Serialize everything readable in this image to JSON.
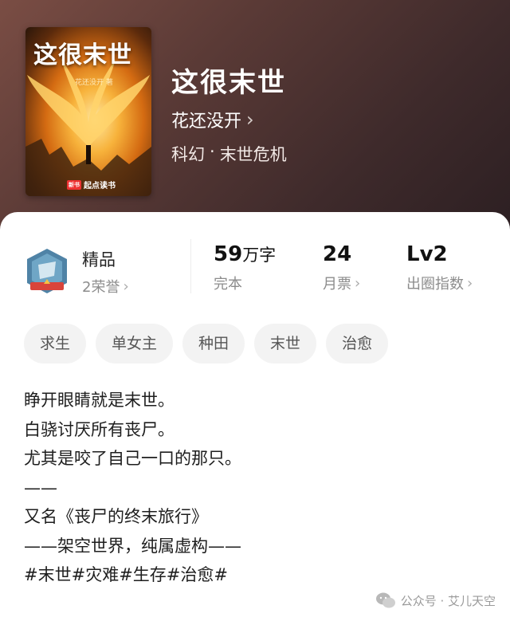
{
  "book": {
    "title": "这很末世",
    "author": "花还没开",
    "author_chevron": "›",
    "genre": "科幻",
    "separator": "·",
    "subgenre": "末世危机"
  },
  "cover": {
    "title": "这很末世",
    "author_line": "花还没开 著",
    "publisher_tag": "新书",
    "publisher": "起点读书"
  },
  "stats": {
    "quality": {
      "label": "精品",
      "honors": "2荣誉"
    },
    "words": {
      "value": "59",
      "unit": "万字",
      "status": "完本"
    },
    "votes": {
      "value": "24",
      "label": "月票"
    },
    "level": {
      "value": "Lv2",
      "label": "出圈指数"
    }
  },
  "tags": [
    "求生",
    "单女主",
    "种田",
    "末世",
    "治愈"
  ],
  "description": [
    "睁开眼睛就是末世。",
    "白骁讨厌所有丧尸。",
    "尤其是咬了自己一口的那只。",
    "——",
    "又名《丧尸的终末旅行》",
    "——架空世界，纯属虚构——",
    "#末世#灾难#生存#治愈#"
  ],
  "watermark": "公众号 · 艾儿天空",
  "colors": {
    "header_dark": "#3e2a2b",
    "header_warm": "#7a4d44",
    "tag_bg": "#f3f3f3"
  }
}
